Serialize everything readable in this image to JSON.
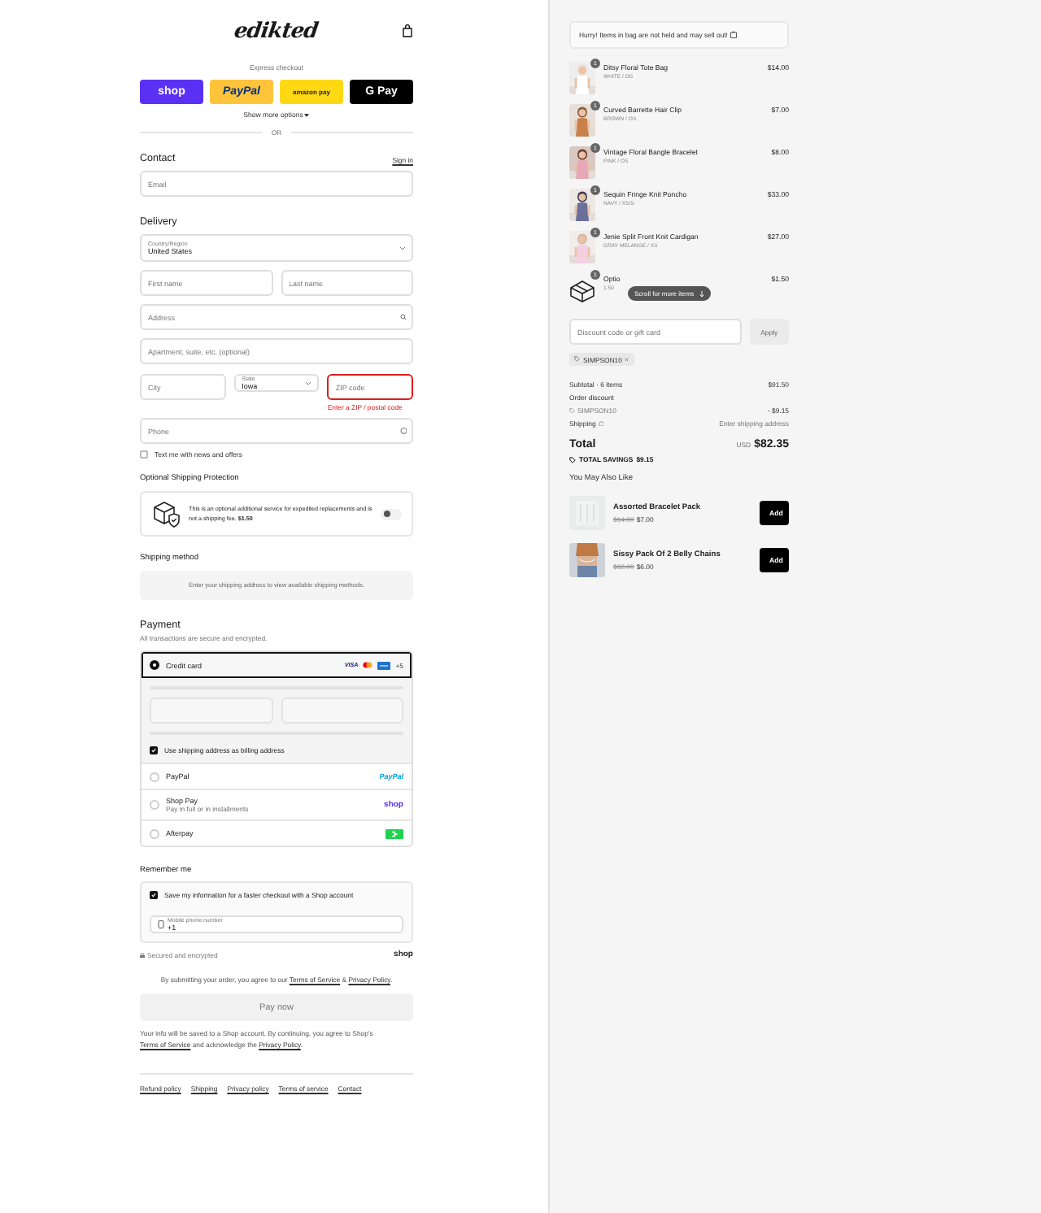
{
  "header": {
    "logo": "edikted"
  },
  "express": {
    "label": "Express checkout",
    "buttons": [
      {
        "kind": "shop",
        "label": "shop"
      },
      {
        "kind": "paypal",
        "label": "PayPal"
      },
      {
        "kind": "amazon",
        "label": "amazon pay"
      },
      {
        "kind": "gpay",
        "label": "G Pay"
      }
    ],
    "more": "Show more options",
    "or": "OR"
  },
  "contact": {
    "title": "Contact",
    "link": "Sign in",
    "email_placeholder": "Email"
  },
  "delivery": {
    "title": "Delivery",
    "country": {
      "label": "Country/Region",
      "value": "United States"
    },
    "first_name": {
      "placeholder": "First name"
    },
    "last_name": {
      "placeholder": "Last name"
    },
    "address": {
      "placeholder": "Address"
    },
    "apartment": {
      "placeholder": "Apartment, suite, etc. (optional)"
    },
    "city": {
      "placeholder": "City"
    },
    "state": {
      "label": "State",
      "value": "Iowa"
    },
    "zip": {
      "placeholder": "ZIP code",
      "error": "Enter a ZIP / postal code"
    },
    "phone": {
      "placeholder": "Phone"
    },
    "sms": {
      "label": "Text me with news and offers",
      "checked": false
    }
  },
  "protection": {
    "title": "Optional Shipping Protection",
    "text": "This is an optional additional service for expedited replacements and is not a shipping fee. **$1.50**",
    "on": false
  },
  "shipping_method": {
    "title": "Shipping method",
    "message": "Enter your shipping address to view available shipping methods."
  },
  "payment": {
    "title": "Payment",
    "subtitle": "All transactions are secure and encrypted.",
    "methods": [
      {
        "kind": "card",
        "label": "Credit card",
        "selected": true,
        "brand": "VISA",
        "more": "+5"
      },
      {
        "kind": "paypal",
        "label": "PayPal",
        "selected": false,
        "logo": "PayPal"
      },
      {
        "kind": "shoppay",
        "label": "Shop Pay",
        "selected": false,
        "sub": "Pay in full or in installments",
        "logo": "shop"
      },
      {
        "kind": "afterpay",
        "label": "Afterpay",
        "selected": false
      }
    ],
    "billing": {
      "label": "Use shipping address as billing address",
      "checked": true
    }
  },
  "remember": {
    "title": "Remember me",
    "save": {
      "label": "Save my information for a faster checkout with a Shop account",
      "checked": true
    },
    "phone": {
      "label": "Mobile phone number",
      "value": "+1"
    },
    "secured": "Secured and encrypted",
    "logo": "shop"
  },
  "terms": [
    {
      "text": "By submitting your order, you agree to our "
    },
    {
      "link": "Terms of Service"
    },
    {
      "text": " & "
    },
    {
      "link": "Privacy Policy"
    },
    {
      "text": "."
    }
  ],
  "pay_button": {
    "label": "Pay now",
    "disabled": true
  },
  "info": [
    {
      "text": "Your info will be saved to a Shop account. By continuing, you agree to Shop's "
    },
    {
      "link": "Terms of Service"
    },
    {
      "text": " and acknowledge the "
    },
    {
      "link": "Privacy Policy"
    },
    {
      "text": "."
    }
  ],
  "footer": [
    "Refund policy",
    "Shipping",
    "Privacy policy",
    "Terms of service",
    "Contact"
  ],
  "summary": {
    "hurry": "Hurry! Items in bag are not held and may sell out!",
    "items": [
      {
        "kind": "picture",
        "qty": "1",
        "name": "Ditsy Floral Tote Bag",
        "variant": "WHITE / OS",
        "price": "$14.00"
      },
      {
        "kind": "picture",
        "qty": "1",
        "name": "Curved Barrette Hair Clip",
        "variant": "BROWN / OS",
        "price": "$7.00"
      },
      {
        "kind": "picture",
        "qty": "1",
        "name": "Vintage Floral Bangle Bracelet",
        "variant": "PINK / OS",
        "price": "$8.00"
      },
      {
        "kind": "picture",
        "qty": "1",
        "name": "Sequin Fringe Knit Poncho",
        "variant": "NAVY / XS/S",
        "price": "$33.00"
      },
      {
        "kind": "picture",
        "qty": "1",
        "name": "Jenie Split Front Knit Cardigan",
        "variant": "GRAY MELANGE / XS",
        "price": "$27.00"
      },
      {
        "kind": "package",
        "qty": "1",
        "name": "Optio",
        "variant": "1.50",
        "price": "$1.50"
      }
    ],
    "scroll_hint": "Scroll for more items",
    "discount": {
      "placeholder": "Discount code or gift card",
      "button": "Apply",
      "tag": "SIMPSON10"
    },
    "rows": [
      {
        "label": "Subtotal · 6 items",
        "value": "$91.50"
      },
      {
        "label": "Order discount"
      },
      {
        "label": "SIMPSON10",
        "value": "- $9.15",
        "kind": "code"
      },
      {
        "label": "Shipping",
        "value": "Enter shipping address",
        "kind": "info"
      }
    ],
    "total": {
      "label": "Total",
      "currency": "USD",
      "amount": "$82.35"
    },
    "savings": {
      "label": "TOTAL SAVINGS",
      "amount": "$9.15"
    },
    "recs_title": "You May Also Like",
    "recs": [
      {
        "name": "Assorted Bracelet Pack",
        "old": "$14.00",
        "price": "$7.00",
        "button": "Add"
      },
      {
        "name": "Sissy Pack Of 2 Belly Chains",
        "old": "$12.00",
        "price": "$6.00",
        "button": "Add"
      }
    ]
  }
}
